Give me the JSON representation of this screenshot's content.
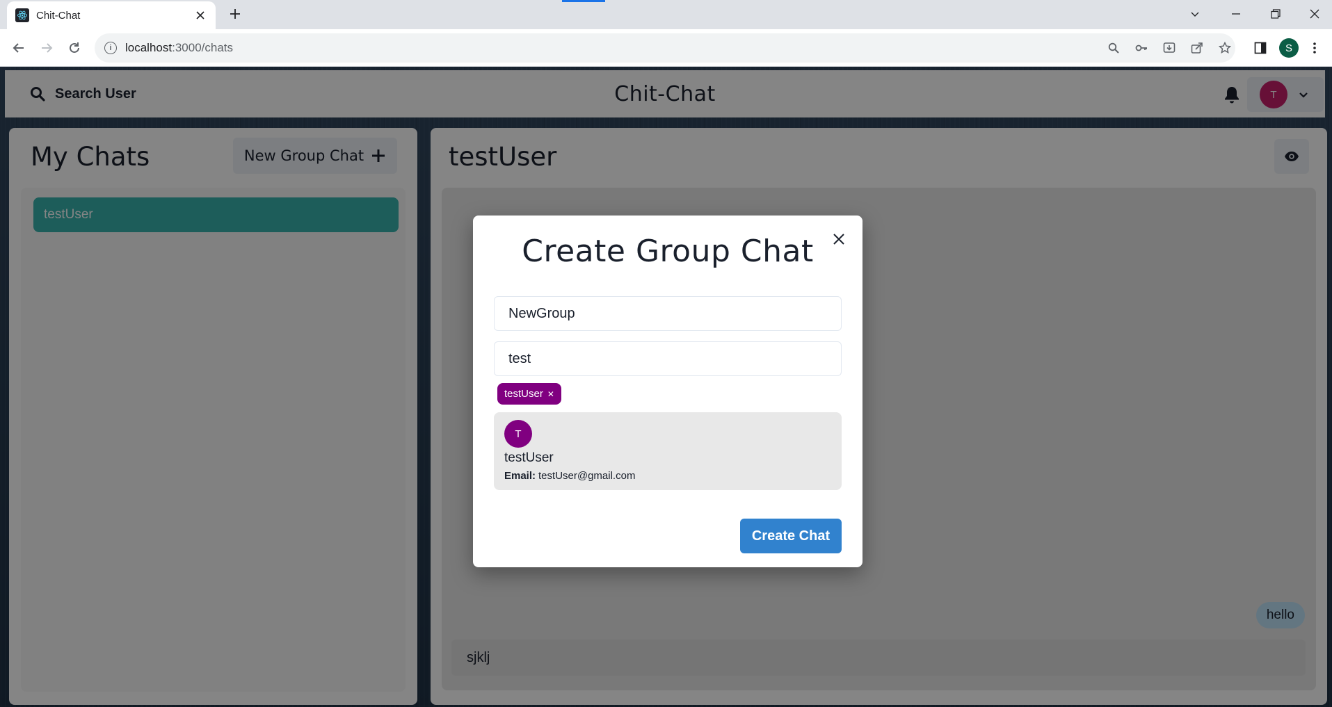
{
  "browser": {
    "tab_title": "Chit-Chat",
    "url_host": "localhost",
    "url_path": ":3000/chats",
    "profile_initial": "S"
  },
  "header": {
    "search_label": "Search User",
    "brand": "Chit-Chat",
    "user_initial": "T"
  },
  "chats": {
    "title": "My Chats",
    "new_group_label": "New Group Chat",
    "items": [
      {
        "label": "testUser",
        "active": true
      }
    ]
  },
  "chat": {
    "title": "testUser",
    "messages": [
      {
        "text": "hello",
        "self": true
      }
    ],
    "input_value": "sjklj"
  },
  "modal": {
    "title": "Create Group Chat",
    "chat_name_value": "NewGroup",
    "search_value": "test",
    "selected_users": [
      {
        "label": "testUser"
      }
    ],
    "results": [
      {
        "initial": "T",
        "name": "testUser",
        "email_label": "Email:",
        "email": "testUser@gmail.com"
      }
    ],
    "create_label": "Create Chat"
  },
  "colors": {
    "accent_teal": "#38B2AC",
    "tag_purple": "#800080",
    "button_blue": "#3182CE",
    "user_avatar": "#C51F6A"
  }
}
